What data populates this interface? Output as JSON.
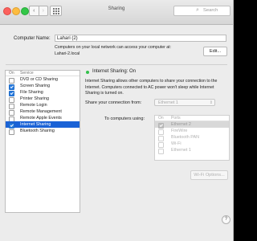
{
  "window": {
    "title": "Sharing"
  },
  "toolbar": {
    "back_icon": "‹",
    "forward_icon": "›",
    "search_placeholder": "Search"
  },
  "computer_name": {
    "label": "Computer Name:",
    "value": "Lahari (2)",
    "info_line1": "Computers on your local network can access your computer at:",
    "info_line2": "Lahari-2.local",
    "edit_label": "Edit..."
  },
  "services": {
    "col_on": "On",
    "col_service": "Service",
    "items": [
      {
        "label": "DVD or CD Sharing",
        "on": false,
        "selected": false
      },
      {
        "label": "Screen Sharing",
        "on": true,
        "selected": false
      },
      {
        "label": "File Sharing",
        "on": true,
        "selected": false
      },
      {
        "label": "Printer Sharing",
        "on": false,
        "selected": false
      },
      {
        "label": "Remote Login",
        "on": false,
        "selected": false
      },
      {
        "label": "Remote Management",
        "on": false,
        "selected": false
      },
      {
        "label": "Remote Apple Events",
        "on": false,
        "selected": false
      },
      {
        "label": "Internet Sharing",
        "on": true,
        "selected": true
      },
      {
        "label": "Bluetooth Sharing",
        "on": false,
        "selected": false
      }
    ]
  },
  "detail": {
    "status": "Internet Sharing: On",
    "status_color": "#32c14b",
    "description": "Internet Sharing allows other computers to share your connection to the Internet. Computers connected to AC power won't sleep while Internet Sharing is turned on.",
    "share_from_label": "Share your connection from:",
    "share_from_value": "Ethernet 1",
    "to_label": "To computers using:",
    "ports_col_on": "On",
    "ports_col_ports": "Ports",
    "ports": [
      {
        "label": "Ethernet 2",
        "on": true,
        "selected": true
      },
      {
        "label": "FireWire",
        "on": false,
        "selected": false
      },
      {
        "label": "Bluetooth PAN",
        "on": false,
        "selected": false
      },
      {
        "label": "Wi-Fi",
        "on": false,
        "selected": false
      },
      {
        "label": "Ethernet 1",
        "on": false,
        "selected": false
      }
    ],
    "wifi_options_label": "Wi-Fi Options...",
    "help_label": "?"
  }
}
